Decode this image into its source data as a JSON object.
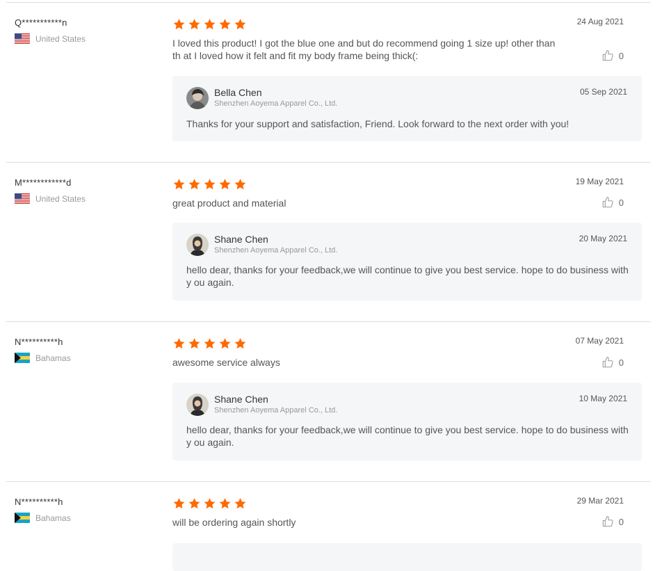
{
  "reviews": [
    {
      "reviewer": "Q***********n",
      "country": "United States",
      "country_flag": "us-flag",
      "rating": 5,
      "date": "24 Aug 2021",
      "text": "I loved this product! I got the blue one and but do recommend going 1 size up! other than th at I loved how it felt and fit my body frame being thick(:",
      "likes": "0",
      "reply": {
        "name": "Bella Chen",
        "company": "Shenzhen Aoyema Apparel Co., Ltd.",
        "date": "05 Sep 2021",
        "text": "Thanks for your support and satisfaction, Friend. Look forward to the next order with you!"
      }
    },
    {
      "reviewer": "M************d",
      "country": "United States",
      "country_flag": "us-flag",
      "rating": 5,
      "date": "19 May 2021",
      "text": "great product and material",
      "likes": "0",
      "reply": {
        "name": "Shane Chen",
        "company": "Shenzhen Aoyema Apparel Co., Ltd.",
        "date": "20 May 2021",
        "text": "hello dear, thanks for your feedback,we will continue to give you best service. hope to do business with y ou again."
      }
    },
    {
      "reviewer": "N**********h",
      "country": "Bahamas",
      "country_flag": "bahamas-flag",
      "rating": 5,
      "date": "07 May 2021",
      "text": "awesome service always",
      "likes": "0",
      "reply": {
        "name": "Shane Chen",
        "company": "Shenzhen Aoyema Apparel Co., Ltd.",
        "date": "10 May 2021",
        "text": "hello dear, thanks for your feedback,we will continue to give you best service. hope to do business with y ou again."
      }
    },
    {
      "reviewer": "N**********h",
      "country": "Bahamas",
      "country_flag": "bahamas-flag",
      "rating": 5,
      "date": "29 Mar 2021",
      "text": "will be ordering again shortly",
      "likes": "0"
    }
  ],
  "colors": {
    "star": "#ff6a00",
    "reply_bg": "#f5f6f7",
    "divider": "#dcdcdc"
  }
}
